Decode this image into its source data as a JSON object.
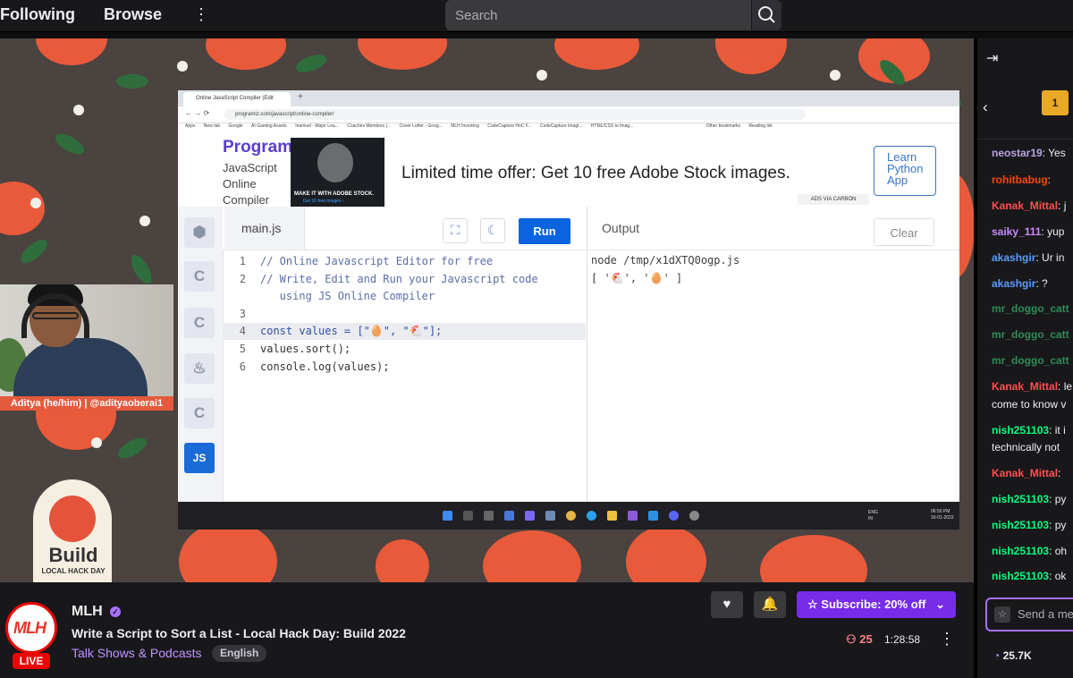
{
  "nav": {
    "following": "Following",
    "browse": "Browse",
    "more": "⋮"
  },
  "search": {
    "placeholder": "Search"
  },
  "webcam": {
    "caption": "Aditya (he/him) | @adityaoberai1"
  },
  "build_badge": {
    "title": "Build",
    "subtitle": "LOCAL HACK DAY"
  },
  "browser": {
    "tab_title": "Online JavaScript Compiler (Edit",
    "url": "programiz.com/javascript/online-compiler/",
    "bookmarks": [
      "Apps",
      "New tab",
      "Google",
      "AI Gaming Assets",
      "Inamuel - Major Lea...",
      "Coaches Members |...",
      "Cover Letter - Goog...",
      "MLH Invoicing",
      "CodeCapture HoC F...",
      "CodeCapture Imagi...",
      "HTML/CSS to Imag...",
      "Other bookmarks",
      "Reading list"
    ]
  },
  "programiz": {
    "logo": "Programiz",
    "subtitle_lines": [
      "JavaScript",
      "Online",
      "Compiler"
    ],
    "ad_caption": "MAKE IT WITH ADOBE STOCK.",
    "ad_caption2": "Get 10 free images ›",
    "ad_text": "Limited time offer: Get 10 free Adobe Stock images.",
    "ads_via": "ADS VIA CARBON",
    "learn_button": "Learn Python App",
    "file_tab": "main.js",
    "run": "Run",
    "output_title": "Output",
    "clear": "Clear",
    "lang_active": "JS",
    "code": [
      {
        "n": "1",
        "text": "// Online Javascript Editor for free"
      },
      {
        "n": "2",
        "text": "// Write, Edit and Run your Javascript code"
      },
      {
        "n": "",
        "text": "   using JS Online Compiler"
      },
      {
        "n": "3",
        "text": ""
      },
      {
        "n": "4",
        "text": "const values = [\"🥚\", \"🐔\"];"
      },
      {
        "n": "5",
        "text": "values.sort();"
      },
      {
        "n": "6",
        "text": "console.log(values);"
      }
    ],
    "output": [
      "node /tmp/x1dXTQ0ogp.js",
      "[ '🐔', '🥚' ]"
    ]
  },
  "taskbar": {
    "lang": "ENG\nIN",
    "time": "06:50 PM\n16-01-2022"
  },
  "channel": {
    "name": "MLH",
    "title": "Write a Script to Sort a List - Local Hack Day: Build 2022",
    "category": "Talk Shows & Podcasts",
    "tag": "English",
    "live": "LIVE",
    "avatar_text": "MLH",
    "subscribe": "Subscribe: 20% off",
    "viewers": "25",
    "uptime": "1:28:58"
  },
  "chat": {
    "gift_count": "1",
    "messages": [
      {
        "user": "neostar19",
        "color": "#b9a3e3",
        "text": ": Yes"
      },
      {
        "user": "rohitbabug",
        "color": "#ff4500",
        "text": ":"
      },
      {
        "user": "Kanak_Mittal",
        "color": "#ff4f4f",
        "text": ": j"
      },
      {
        "user": "saiky_111",
        "color": "#c78bff",
        "text": ": yup"
      },
      {
        "user": "akashgir",
        "color": "#5b9bff",
        "text": ": Ur in"
      },
      {
        "user": "akashgir",
        "color": "#5b9bff",
        "text": ": ?"
      },
      {
        "user": "mr_doggo_catt",
        "color": "#2e8b57",
        "text": ""
      },
      {
        "user": "mr_doggo_catt",
        "color": "#2e8b57",
        "text": ""
      },
      {
        "user": "mr_doggo_catt",
        "color": "#2e8b57",
        "text": ""
      },
      {
        "user": "Kanak_Mittal",
        "color": "#ff4f4f",
        "text": ": le"
      },
      {
        "user": "",
        "color": "#efeff1",
        "text": "come to know v"
      },
      {
        "user": "nish251103",
        "color": "#00ff7f",
        "text": ": it i"
      },
      {
        "user": "",
        "color": "#efeff1",
        "text": "technically not"
      },
      {
        "user": "Kanak_Mittal",
        "color": "#ff4f4f",
        "text": ":"
      },
      {
        "user": "nish251103",
        "color": "#00ff7f",
        "text": ": py"
      },
      {
        "user": "nish251103",
        "color": "#00ff7f",
        "text": ": py"
      },
      {
        "user": "nish251103",
        "color": "#00ff7f",
        "text": ": oh"
      },
      {
        "user": "nish251103",
        "color": "#00ff7f",
        "text": ": ok"
      }
    ],
    "input_placeholder": "Send a message",
    "points": "25.7K"
  }
}
